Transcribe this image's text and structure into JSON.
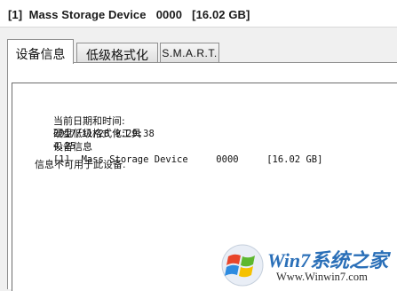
{
  "device_header": {
    "title": "[1]  Mass Storage Device   0000   [16.02 GB]"
  },
  "tabs": [
    {
      "label": "设备信息",
      "active": true
    },
    {
      "label": "低级格式化",
      "active": false
    },
    {
      "label": "S.M.A.R.T.",
      "active": false
    }
  ],
  "report": {
    "datetime_label": "当前日期和时间:",
    "datetime_value": "2017/11/28 9:29:38",
    "tool_label": "硬盘低级格式化工具",
    "tool_version": "4.25",
    "device_label": "设备信息",
    "device_value": "[1]  Mass Storage Device     0000     [16.02 GB]",
    "not_available": "信息不可用于此设备."
  },
  "watermark": {
    "brand": "Win7系统之家",
    "url": "Www.Winwin7.com"
  }
}
